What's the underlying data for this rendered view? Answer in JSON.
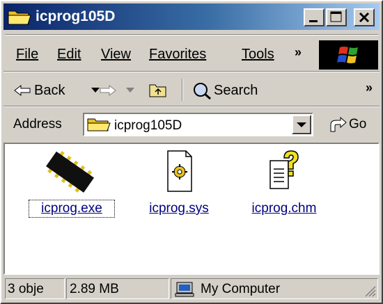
{
  "window": {
    "title": "icprog105D"
  },
  "menu": {
    "items": [
      "File",
      "Edit",
      "View",
      "Favorites",
      "Tools"
    ],
    "more": "»"
  },
  "toolbar": {
    "back_label": "Back",
    "search_label": "Search",
    "more": "»"
  },
  "address": {
    "label": "Address",
    "value": "icprog105D",
    "go_label": "Go"
  },
  "files": [
    {
      "name": "icprog.exe",
      "icon": "ic-chip-icon",
      "selected": true
    },
    {
      "name": "icprog.sys",
      "icon": "system-file-gear-icon",
      "selected": false
    },
    {
      "name": "icprog.chm",
      "icon": "help-file-icon",
      "selected": false
    }
  ],
  "status": {
    "objects": "3 obje",
    "size": "2.89 MB",
    "zone": "My Computer"
  },
  "colors": {
    "titlebar_start": "#0a246a",
    "titlebar_end": "#a6caf0",
    "face": "#d4d0c8",
    "link": "#000080"
  }
}
